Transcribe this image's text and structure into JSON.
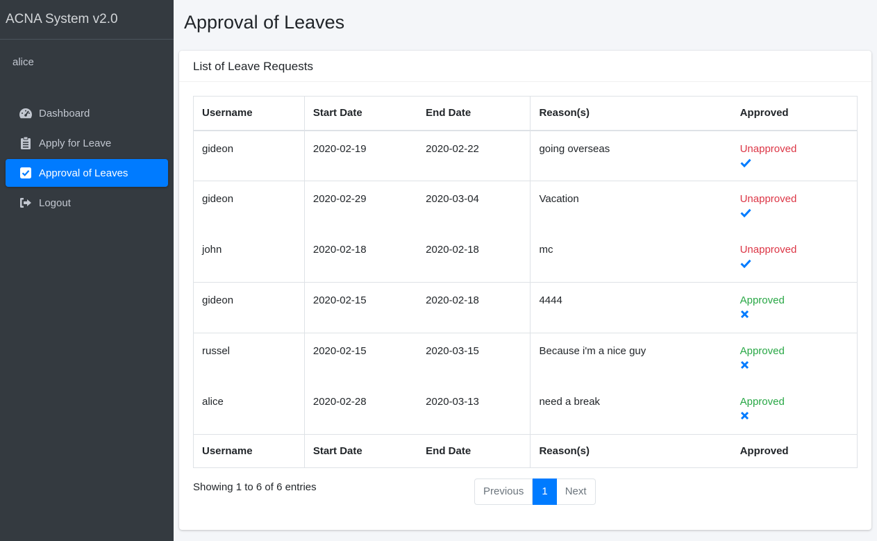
{
  "app": {
    "title": "ACNA System v2.0",
    "user": "alice"
  },
  "sidebar": {
    "items": [
      {
        "label": "Dashboard",
        "icon": "tachometer-icon"
      },
      {
        "label": "Apply for Leave",
        "icon": "clipboard-icon"
      },
      {
        "label": "Approval of Leaves",
        "icon": "checkbox-icon",
        "active": true
      },
      {
        "label": "Logout",
        "icon": "sign-out-icon"
      }
    ]
  },
  "page": {
    "title": "Approval of Leaves"
  },
  "card": {
    "title": "List of Leave Requests"
  },
  "table": {
    "headers": [
      "Username",
      "Start Date",
      "End Date",
      "Reason(s)",
      "Approved"
    ],
    "rows": [
      {
        "username": "gideon",
        "start": "2020-02-19",
        "end": "2020-02-22",
        "reason": "going overseas",
        "status": "Unapproved",
        "action": "approve-check-icon"
      },
      {
        "username": "gideon",
        "start": "2020-02-29",
        "end": "2020-03-04",
        "reason": "Vacation",
        "status": "Unapproved",
        "action": "approve-check-icon"
      },
      {
        "username": "john",
        "start": "2020-02-18",
        "end": "2020-02-18",
        "reason": "mc",
        "status": "Unapproved",
        "action": "approve-check-icon"
      },
      {
        "username": "gideon",
        "start": "2020-02-15",
        "end": "2020-02-18",
        "reason": "4444",
        "status": "Approved",
        "action": "unapprove-x-icon"
      },
      {
        "username": "russel",
        "start": "2020-02-15",
        "end": "2020-03-15",
        "reason": "Because i'm a nice guy",
        "status": "Approved",
        "action": "unapprove-x-icon"
      },
      {
        "username": "alice",
        "start": "2020-02-28",
        "end": "2020-03-13",
        "reason": "need a break",
        "status": "Approved",
        "action": "unapprove-x-icon"
      }
    ]
  },
  "info": "Showing 1 to 6 of 6 entries",
  "pagination": {
    "previous": "Previous",
    "current": "1",
    "next": "Next"
  },
  "colors": {
    "sidebar": "#343a40",
    "accent": "#007bff",
    "unapproved": "#dc3545",
    "approved": "#28a745"
  }
}
